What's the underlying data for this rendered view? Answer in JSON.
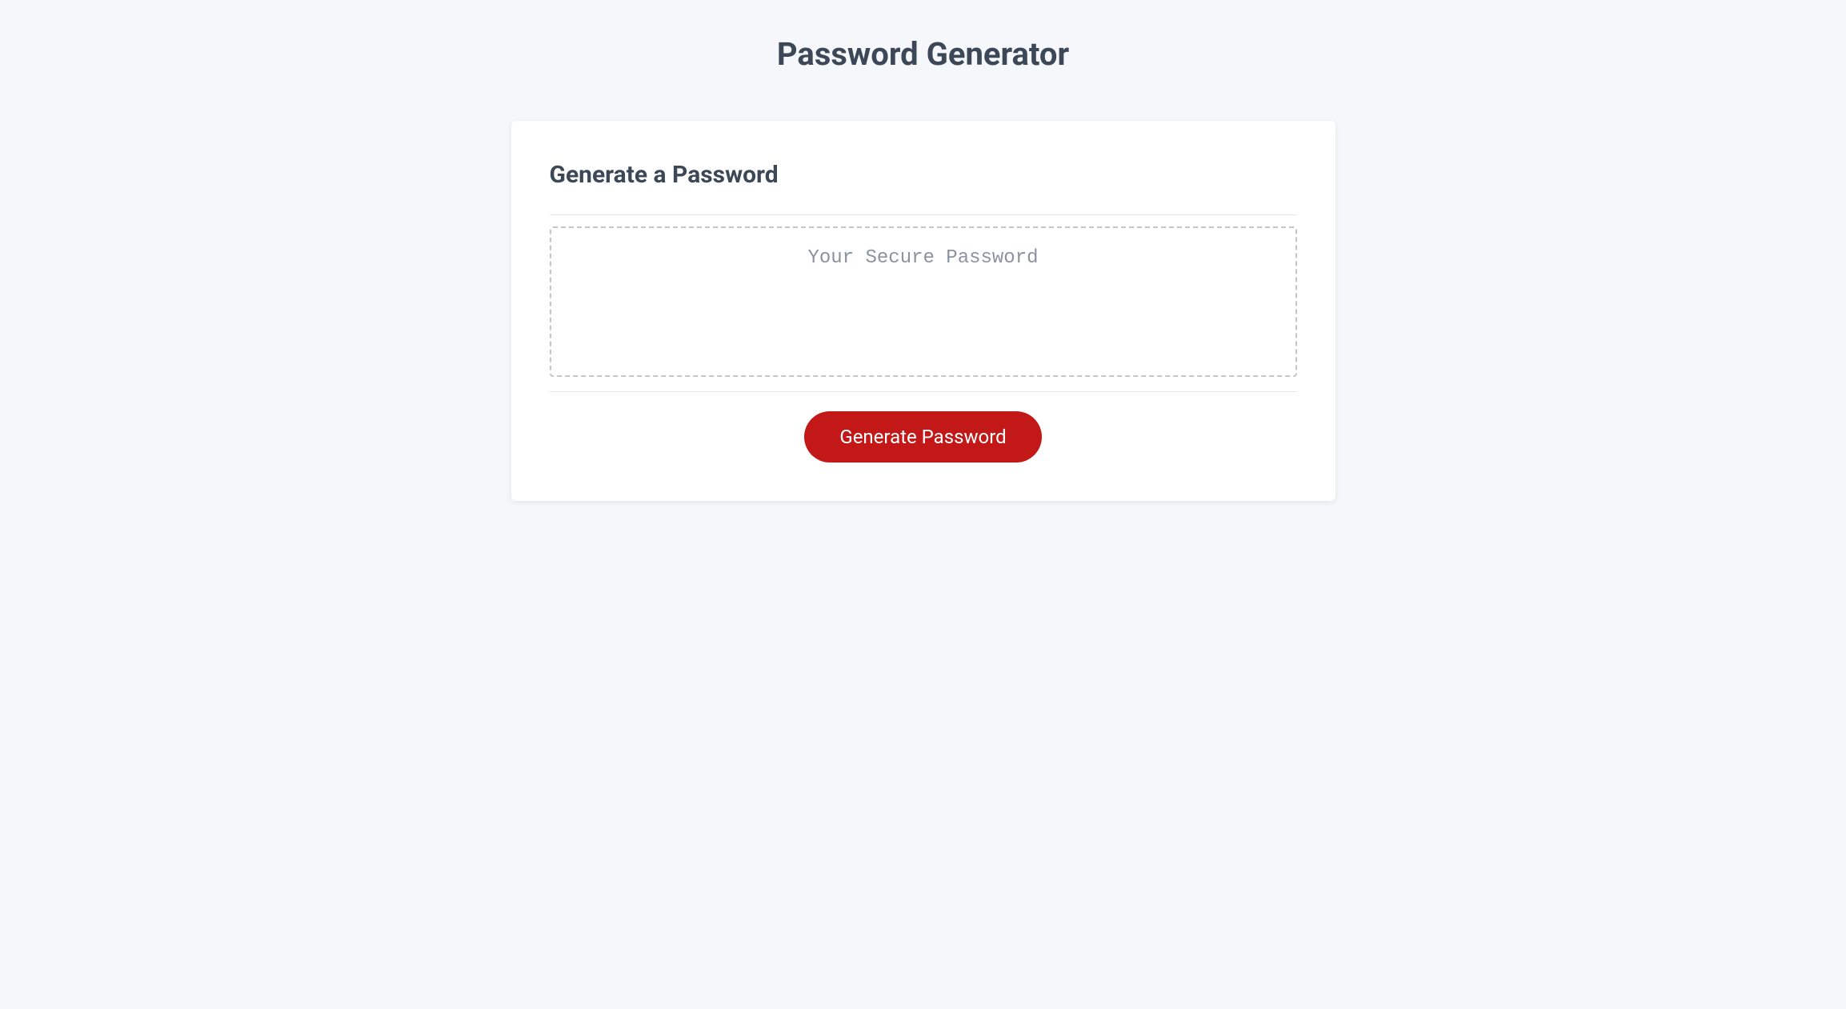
{
  "header": {
    "title": "Password Generator"
  },
  "card": {
    "heading": "Generate a Password",
    "output_placeholder": "Your Secure Password",
    "output_value": "",
    "generate_button_label": "Generate Password"
  },
  "colors": {
    "page_bg": "#f5f7fa",
    "card_bg": "#ffffff",
    "text_primary": "#3c4858",
    "placeholder": "#8a939f",
    "dashed_border": "#c2c6cc",
    "divider": "#e5e7eb",
    "button_bg": "#c21818",
    "button_text": "#ffffff"
  }
}
